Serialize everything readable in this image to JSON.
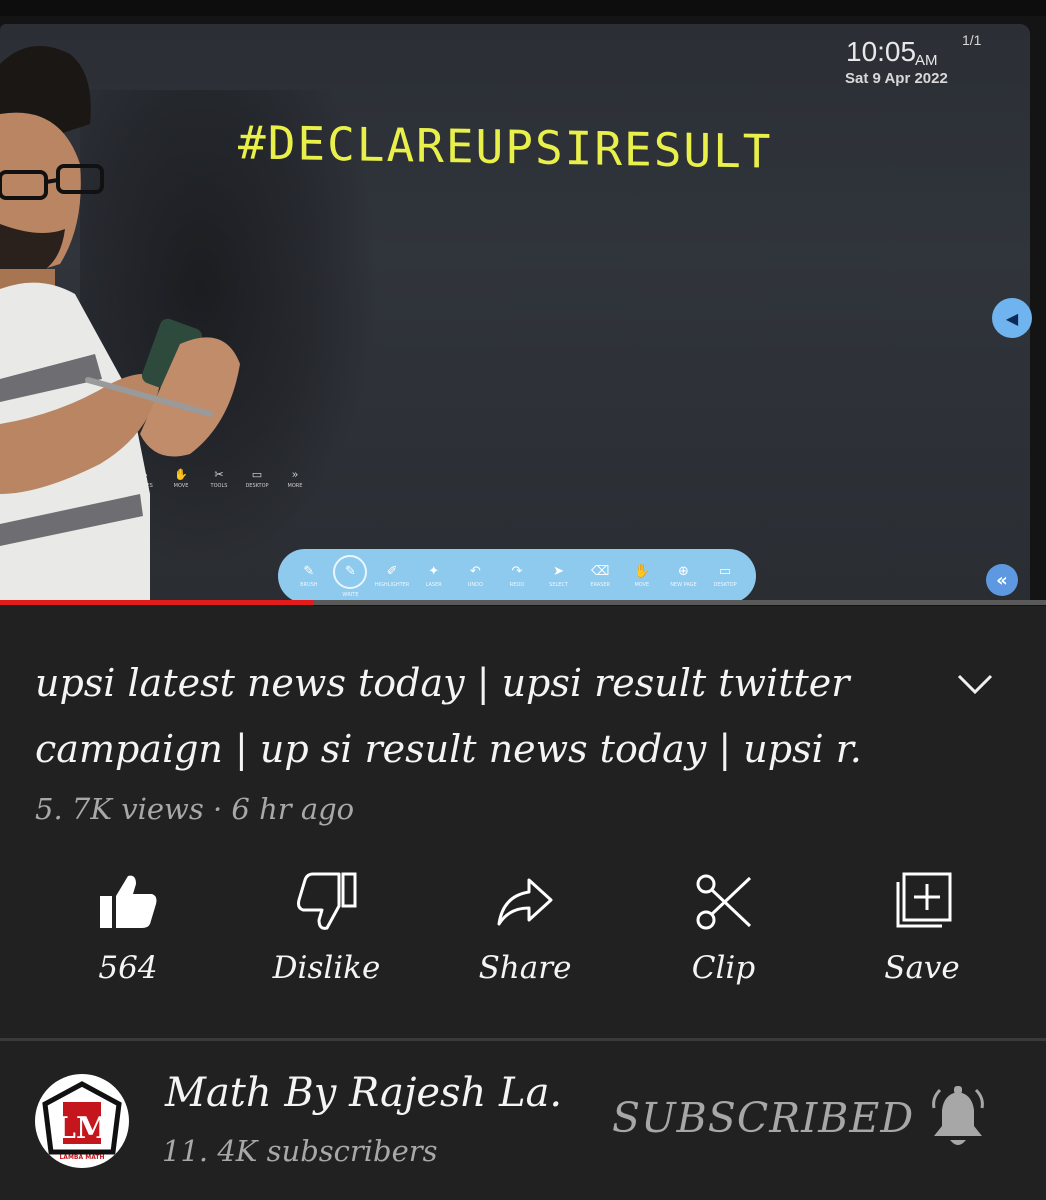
{
  "player": {
    "board": {
      "time": "10:05",
      "ampm": "AM",
      "date": "Sat 9 Apr 2022",
      "page": "1/1",
      "text": "#DECLAREUPSIRESULT"
    },
    "small_toolbar": [
      "SHAPES",
      "MOVE",
      "TOOLS",
      "DESKTOP",
      "MORE"
    ],
    "pen_toolbar": [
      {
        "label": "BRUSH",
        "glyph": "✎"
      },
      {
        "label": "WRITE",
        "glyph": "✎"
      },
      {
        "label": "HIGHLIGHTER",
        "glyph": "✐"
      },
      {
        "label": "LASER",
        "glyph": "✦"
      },
      {
        "label": "UNDO",
        "glyph": "↶"
      },
      {
        "label": "REDO",
        "glyph": "↷"
      },
      {
        "label": "SELECT",
        "glyph": "➤"
      },
      {
        "label": "ERASER",
        "glyph": "⌫"
      },
      {
        "label": "MOVE",
        "glyph": "✋"
      },
      {
        "label": "NEW PAGE",
        "glyph": "⊕"
      },
      {
        "label": "DESKTOP",
        "glyph": "▭"
      }
    ],
    "progress": 0.3,
    "colors": {
      "board_text": "#e9f04a",
      "toolbar": "#8ec9ee",
      "progress": "#e21b1b"
    }
  },
  "video": {
    "title_line1": "upsi latest news today | upsi result twitter",
    "title_line2": "campaign | up si result news today | upsi r.",
    "meta": "5. 7K views · 6 hr ago"
  },
  "actions": [
    {
      "name": "like",
      "label": "564",
      "icon": "thumbs-up-filled-icon"
    },
    {
      "name": "dislike",
      "label": "Dislike",
      "icon": "thumbs-down-outline-icon"
    },
    {
      "name": "share",
      "label": "Share",
      "icon": "share-arrow-icon"
    },
    {
      "name": "clip",
      "label": "Clip",
      "icon": "scissors-icon"
    },
    {
      "name": "save",
      "label": "Save",
      "icon": "add-to-playlist-icon"
    }
  ],
  "channel": {
    "name": "Math By Rajesh La.",
    "subscribers": "11. 4K subscribers",
    "subscribe_label": "SUBSCRIBED",
    "logo_letters": "LM",
    "logo_caption": "LAMBA MATH"
  }
}
